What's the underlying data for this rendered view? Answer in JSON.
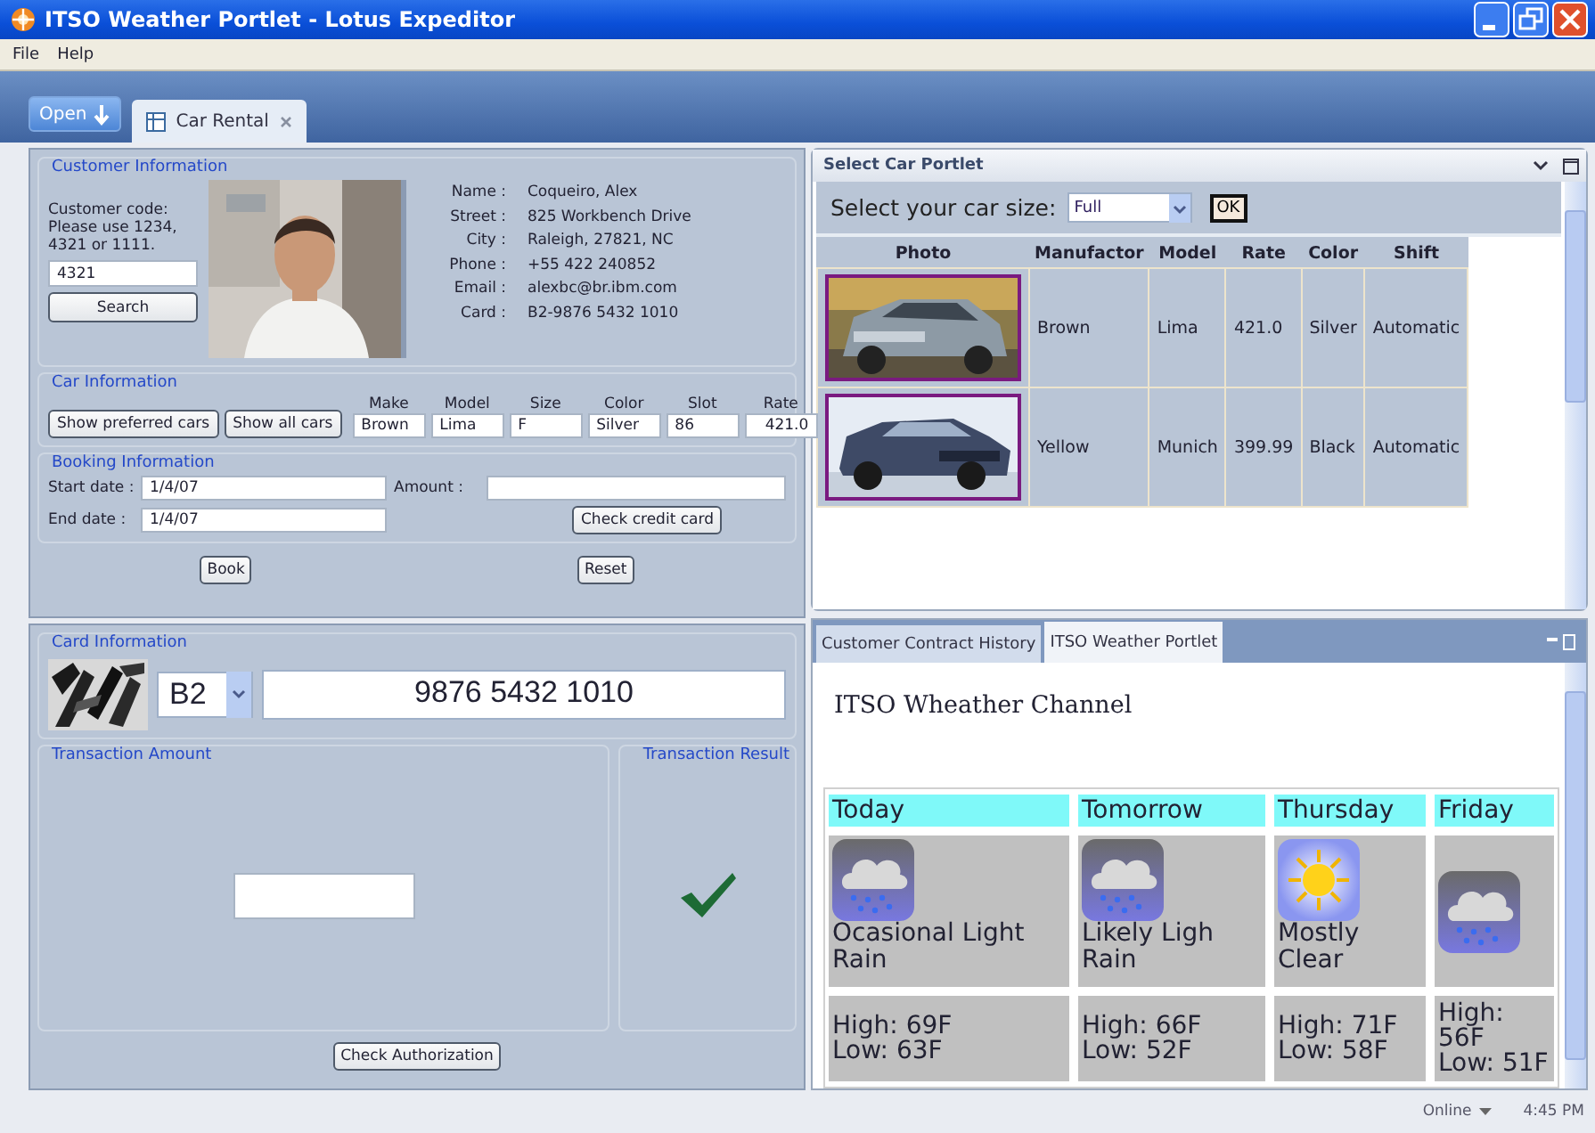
{
  "window": {
    "title": "ITSO Weather Portlet - Lotus Expeditor"
  },
  "menu": [
    {
      "label": "File"
    },
    {
      "label": "Help"
    }
  ],
  "open_button": "Open",
  "tabs": [
    {
      "label": "Car Rental",
      "selected": true
    }
  ],
  "customer_info": {
    "title": "Customer Information",
    "prompt": "Customer code: Please use 1234, 4321 or 1111.",
    "code": "4321",
    "search_button": "Search",
    "fields": [
      {
        "label": "Name :",
        "value": "Coqueiro, Alex"
      },
      {
        "label": "Street :",
        "value": "825 Workbench Drive"
      },
      {
        "label": "City :",
        "value": "Raleigh, 27821, NC"
      },
      {
        "label": "Phone :",
        "value": "+55 422 240852"
      },
      {
        "label": "Email :",
        "value": "alexbc@br.ibm.com"
      },
      {
        "label": "Card :",
        "value": "B2-9876 5432 1010"
      }
    ]
  },
  "car_info": {
    "title": "Car Information",
    "buttons": [
      "Show preferred cars",
      "Show all cars"
    ],
    "fields": [
      {
        "label": "Make",
        "value": "Brown"
      },
      {
        "label": "Model",
        "value": "Lima"
      },
      {
        "label": "Size",
        "value": "F"
      },
      {
        "label": "Color",
        "value": "Silver"
      },
      {
        "label": "Slot",
        "value": "86"
      },
      {
        "label": "Rate",
        "value": "421.0"
      }
    ]
  },
  "booking": {
    "title": "Booking Information",
    "start_label": "Start date :",
    "start_date": "1/4/07",
    "end_label": "End date :",
    "end_date": "1/4/07",
    "amount_label": "Amount :",
    "check_button": "Check credit card"
  },
  "actions": [
    "Book",
    "Reset"
  ],
  "card_info": {
    "title": "Card Information",
    "prefix": "B2",
    "number": "9876 5432 1010"
  },
  "transaction_amount": {
    "title": "Transaction Amount"
  },
  "transaction_result": {
    "title": "Transaction Result"
  },
  "check_authorization": "Check Authorization",
  "select_car": {
    "title": "Select Car Portlet",
    "prompt": "Select your car size:",
    "size": "Full",
    "ok": "OK",
    "columns": [
      "Photo",
      "Manufactor",
      "Model",
      "Rate",
      "Color",
      "Shift"
    ],
    "rows": [
      {
        "cells": [
          "",
          "Brown",
          "Lima",
          "421.0",
          "Silver",
          "Automatic"
        ]
      },
      {
        "cells": [
          "",
          "Yellow",
          "Munich",
          "399.99",
          "Black",
          "Automatic"
        ]
      }
    ]
  },
  "weather": {
    "tabs": [
      {
        "label": "Customer Contract History",
        "selected": false
      },
      {
        "label": "ITSO Weather Portlet",
        "selected": true
      }
    ],
    "heading": "ITSO Wheather Channel",
    "days": [
      {
        "name": "Today",
        "kind": "rain",
        "description": "Ocasional Light Rain",
        "high": "High: 69F",
        "low": "Low: 63F"
      },
      {
        "name": "Tomorrow",
        "kind": "rain",
        "description": "Likely Ligh Rain",
        "high": "High: 66F",
        "low": "Low: 52F"
      },
      {
        "name": "Thursday",
        "kind": "sun",
        "description": "Mostly Clear",
        "high": "High: 71F",
        "low": "Low: 58F"
      },
      {
        "name": "Friday",
        "kind": "rain",
        "high": "High: 56F",
        "low": "Low: 51F"
      }
    ]
  },
  "status_bar": {
    "status": "Online",
    "time": "4:45 PM"
  }
}
